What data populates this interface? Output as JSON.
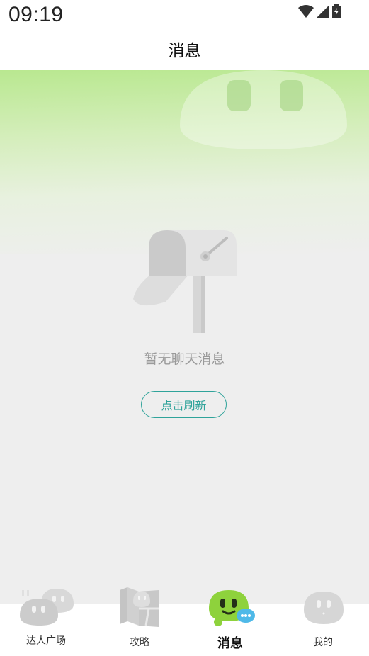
{
  "status_bar": {
    "time": "09:19",
    "icons": [
      "wifi-icon",
      "signal-icon",
      "battery-charging-icon"
    ]
  },
  "header": {
    "title": "消息"
  },
  "empty_state": {
    "illustration": "mailbox-icon",
    "message": "暂无聊天消息",
    "refresh_label": "点击刷新"
  },
  "bottom_nav": {
    "items": [
      {
        "label": "达人广场",
        "icon": "blob-duo-icon",
        "active": false
      },
      {
        "label": "攻略",
        "icon": "map-blob-icon",
        "active": false
      },
      {
        "label": "消息",
        "icon": "message-blob-icon",
        "active": true
      },
      {
        "label": "我的",
        "icon": "blob-profile-icon",
        "active": false
      }
    ]
  },
  "colors": {
    "accent": "#2fa39a",
    "active_green": "#8ed23c",
    "hero_green": "#b9e890",
    "background": "#eeeeee"
  }
}
